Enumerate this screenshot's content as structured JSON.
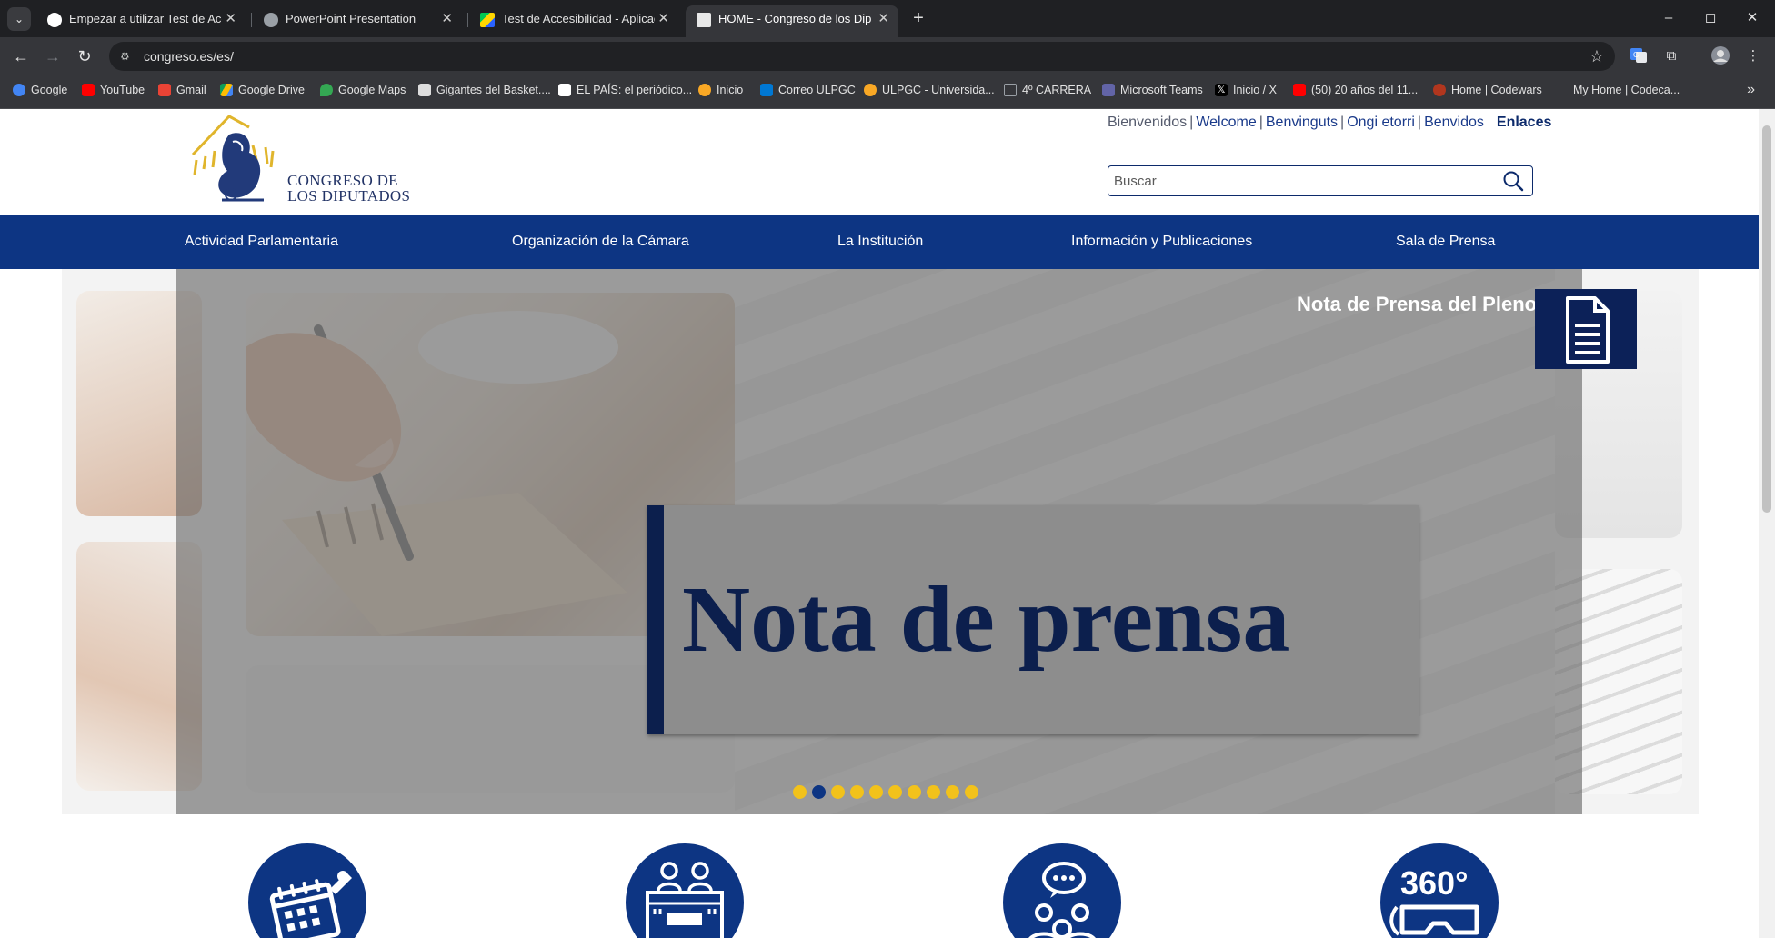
{
  "browser": {
    "tabs": [
      {
        "title": "Empezar a utilizar Test de Accesibilidad",
        "favicon": "google-icon",
        "active": false
      },
      {
        "title": "PowerPoint Presentation",
        "favicon": "globe-icon",
        "active": false
      },
      {
        "title": "Test de Accesibilidad - Aplicaciones",
        "favicon": "play-store-icon",
        "active": false
      },
      {
        "title": "HOME - Congreso de los Diputados",
        "favicon": "congreso-icon",
        "active": true
      }
    ],
    "url": "congreso.es/es/",
    "bookmarks": [
      {
        "label": "Google",
        "color": "#4285f4"
      },
      {
        "label": "YouTube",
        "color": "#ff0000"
      },
      {
        "label": "Gmail",
        "color": "#ea4335"
      },
      {
        "label": "Google Drive",
        "color": "#fbbc04"
      },
      {
        "label": "Google Maps",
        "color": "#34a853"
      },
      {
        "label": "Gigantes del Basket....",
        "color": "#dddddd"
      },
      {
        "label": "EL PAÍS: el periódico...",
        "color": "#ffffff"
      },
      {
        "label": "Inicio",
        "color": "#f9a825"
      },
      {
        "label": "Correo ULPGC",
        "color": "#0078d4"
      },
      {
        "label": "ULPGC - Universida...",
        "color": "#f9a825"
      },
      {
        "label": "4º CARRERA",
        "color": "#9aa0a6"
      },
      {
        "label": "Microsoft Teams",
        "color": "#6264a7"
      },
      {
        "label": "Inicio / X",
        "color": "#ffffff"
      },
      {
        "label": "(50) 20 años del 11...",
        "color": "#ff0000"
      },
      {
        "label": "Home | Codewars",
        "color": "#b1361e"
      },
      {
        "label": "My Home | Codeca...",
        "color": "#35363a"
      }
    ]
  },
  "site": {
    "logo_line1": "CONGRESO DE",
    "logo_line2": "LOS DIPUTADOS",
    "languages": [
      "Bienvenidos",
      "Welcome",
      "Benvinguts",
      "Ongi etorri",
      "Benvidos"
    ],
    "links_label": "Enlaces",
    "search_placeholder": "Buscar",
    "nav": [
      "Actividad Parlamentaria",
      "Organización de la Cámara",
      "La Institución",
      "Información y Publicaciones",
      "Sala de Prensa"
    ],
    "slide": {
      "title": "Nota de Prensa del Pleno",
      "banner_text": "Nota de prensa",
      "dots_total": 10,
      "active_dot": 2
    },
    "feature_icons": [
      "calendar-icon",
      "congress-podium-icon",
      "people-chat-icon",
      "virtual-tour-360-icon"
    ]
  },
  "colors": {
    "brand_blue": "#0d3583",
    "dark_navy": "#0c1f4d",
    "accent_yellow": "#f2c21b"
  }
}
